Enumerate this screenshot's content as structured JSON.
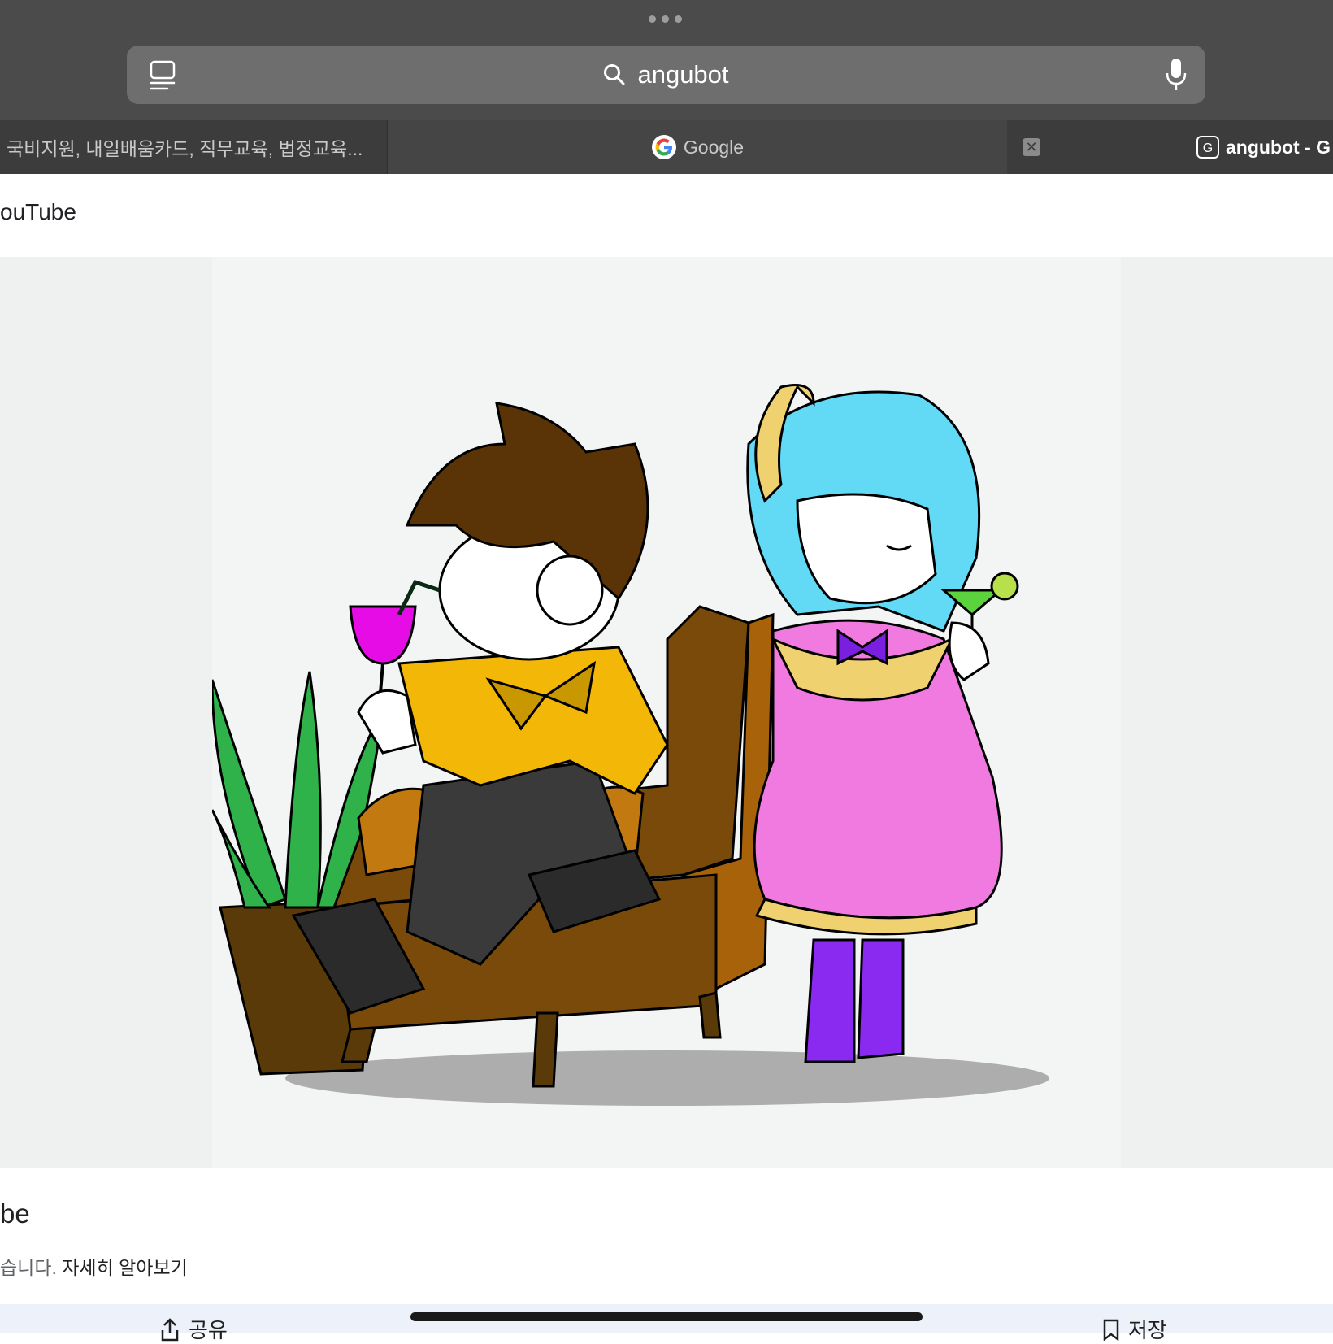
{
  "browser": {
    "search_query": "angubot",
    "tabs": [
      {
        "label": "국비지원, 내일배움카드, 직무교육, 법정교육..."
      },
      {
        "label": "Google"
      },
      {
        "label": "angubot - G"
      }
    ],
    "active_tab_badge": "G",
    "close_glyph": "✕"
  },
  "content": {
    "source_title": "ouTube",
    "result_title": "be",
    "description_text": "습니다. ",
    "learn_more_link": "자세히 알아보기"
  },
  "actions": {
    "share_label": "공유",
    "save_label": "저장"
  },
  "icons": [
    "tabs-overview-icon",
    "search-icon",
    "microphone-icon",
    "google-logo-icon",
    "close-tab-icon",
    "share-icon",
    "bookmark-icon"
  ],
  "colors": {
    "chrome_dark": "#4b4b4b",
    "tabstrip": "#3c3c3c",
    "urlbar": "#6e6e6e",
    "image_bg": "#eff0f0"
  }
}
